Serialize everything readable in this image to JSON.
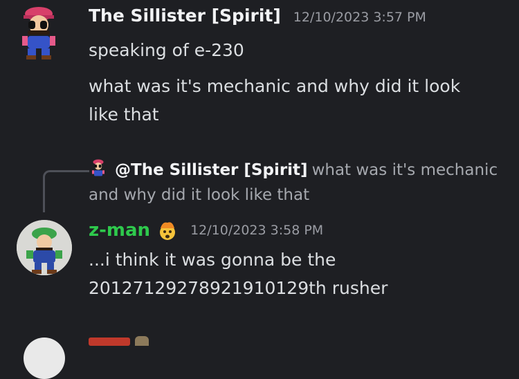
{
  "messages": [
    {
      "author": "The Sillister [Spirit]",
      "timestamp": "12/10/2023 3:57 PM",
      "lines": [
        "speaking of e-230",
        "what was it's mechanic and why did it look",
        "like that"
      ]
    },
    {
      "reply": {
        "author": "@The Sillister [Spirit]",
        "text_line1": "what was it's mechanic",
        "text_line2": "and why did it look like that"
      },
      "author": "z-man",
      "timestamp": "12/10/2023 3:58 PM",
      "lines": [
        "...i think it was gonna be the",
        "20127129278921910129th rusher"
      ]
    }
  ],
  "colors": {
    "background": "#1e1f23",
    "zman_name": "#2ec94c",
    "timestamp": "#9a9ca3"
  },
  "icons": [
    "mario-avatar-icon",
    "luigi-avatar-icon",
    "exploding-head-emoji-icon"
  ]
}
